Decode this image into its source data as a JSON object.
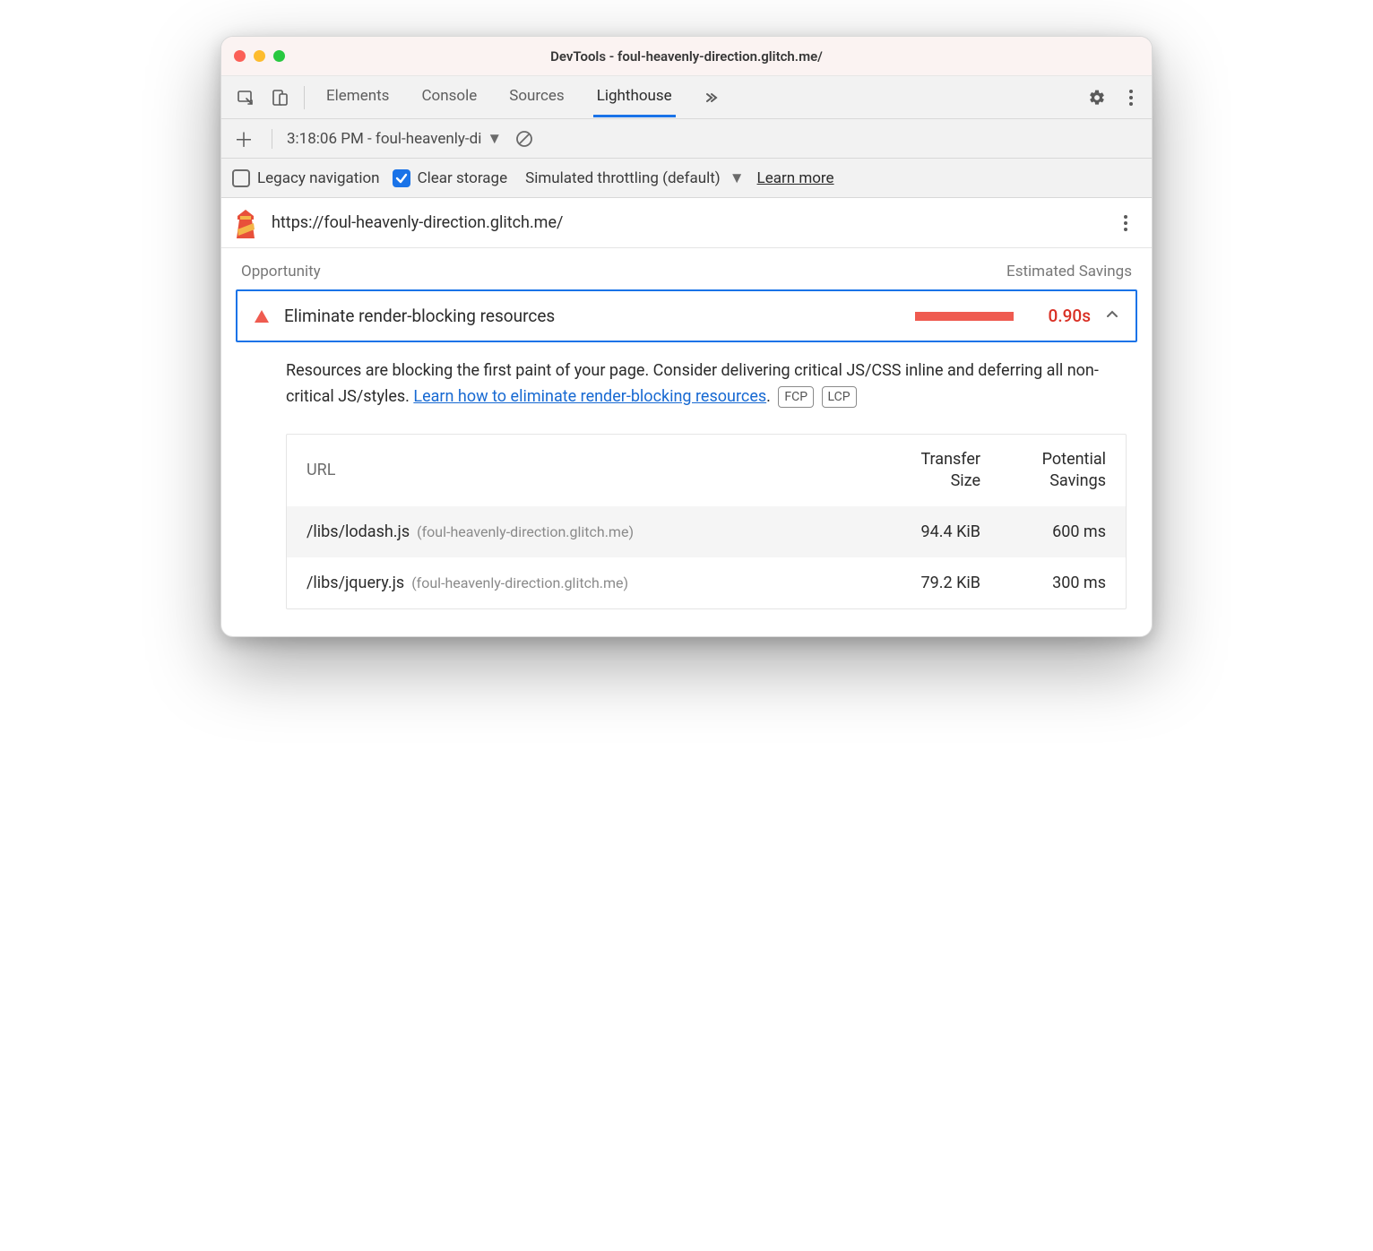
{
  "window": {
    "title": "DevTools - foul-heavenly-direction.glitch.me/",
    "traffic_lights": {
      "close": "#fb5f57",
      "min": "#fdbc2e",
      "max": "#28c840"
    }
  },
  "tabbar": {
    "tabs": [
      "Elements",
      "Console",
      "Sources",
      "Lighthouse"
    ],
    "active_index": 3
  },
  "subtoolbar": {
    "report_label": "3:18:06 PM - foul-heavenly-di"
  },
  "options": {
    "legacy_label": "Legacy navigation",
    "legacy_checked": false,
    "clear_label": "Clear storage",
    "clear_checked": true,
    "throttling_label": "Simulated throttling (default)",
    "learn_more": "Learn more"
  },
  "url_row": {
    "url": "https://foul-heavenly-direction.glitch.me/"
  },
  "opportunity": {
    "header_left": "Opportunity",
    "header_right": "Estimated Savings",
    "title": "Eliminate render-blocking resources",
    "value": "0.90s",
    "desc_before_link": "Resources are blocking the first paint of your page. Consider delivering critical JS/CSS inline and deferring all non-critical JS/styles. ",
    "link_text": "Learn how to eliminate render-blocking resources",
    "desc_after_link": ".",
    "badges": [
      "FCP",
      "LCP"
    ]
  },
  "table": {
    "headers": {
      "url": "URL",
      "size": "Transfer Size",
      "savings": "Potential Savings"
    },
    "rows": [
      {
        "path": "/libs/lodash.js",
        "host": "(foul-heavenly-direction.glitch.me)",
        "size": "94.4 KiB",
        "savings": "600 ms"
      },
      {
        "path": "/libs/jquery.js",
        "host": "(foul-heavenly-direction.glitch.me)",
        "size": "79.2 KiB",
        "savings": "300 ms"
      }
    ]
  }
}
